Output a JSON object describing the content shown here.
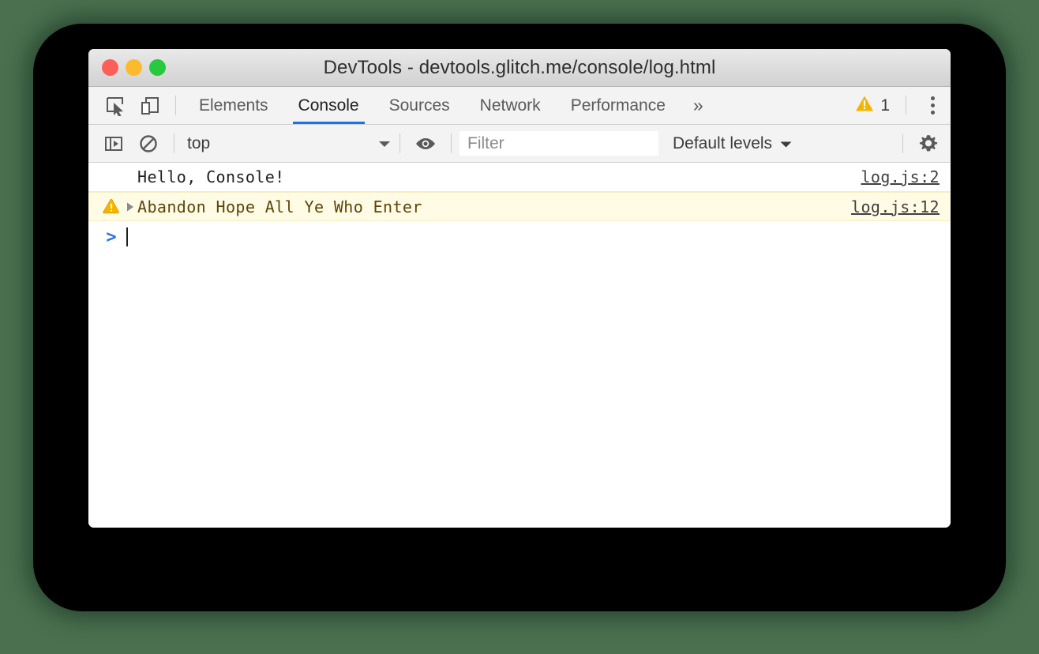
{
  "window": {
    "title": "DevTools - devtools.glitch.me/console/log.html",
    "traffic_lights": [
      {
        "name": "close",
        "color": "#fc5f57"
      },
      {
        "name": "minimize",
        "color": "#fcbb2e"
      },
      {
        "name": "maximize",
        "color": "#28c93f"
      }
    ]
  },
  "tabbar": {
    "left_icons": [
      {
        "name": "inspect-element-icon"
      },
      {
        "name": "device-toolbar-icon"
      }
    ],
    "tabs": [
      {
        "label": "Elements",
        "active": false
      },
      {
        "label": "Console",
        "active": true
      },
      {
        "label": "Sources",
        "active": false
      },
      {
        "label": "Network",
        "active": false
      },
      {
        "label": "Performance",
        "active": false
      }
    ],
    "overflow_label": "»",
    "warning_count": "1",
    "warning_color": "#f5b400",
    "active_tab_underline_color": "#1a73e8"
  },
  "console_toolbar": {
    "sidebar_toggle": "console-sidebar-icon",
    "clear_console": "clear-console-icon",
    "context": {
      "value": "top",
      "chevron": "▼"
    },
    "eye_icon": "live-expression-eye-icon",
    "filter": {
      "placeholder": "Filter",
      "value": ""
    },
    "levels": {
      "label": "Default levels",
      "chevron": "▼"
    },
    "settings_icon": "gear-icon"
  },
  "console_messages": [
    {
      "level": "log",
      "text": "Hello, Console!",
      "source": "log.js:2",
      "has_icon": false,
      "has_disclosure": false
    },
    {
      "level": "warning",
      "text": "Abandon Hope All Ye Who Enter",
      "source": "log.js:12",
      "has_icon": true,
      "has_disclosure": true,
      "background": "#fffbe5",
      "text_color": "#5c4509"
    }
  ],
  "prompt": {
    "symbol": ">",
    "value": ""
  },
  "theme": {
    "page_background": "#4a7050",
    "backdrop": "#000000",
    "window_background": "#ffffff",
    "toolbar_background": "#f3f3f3"
  }
}
